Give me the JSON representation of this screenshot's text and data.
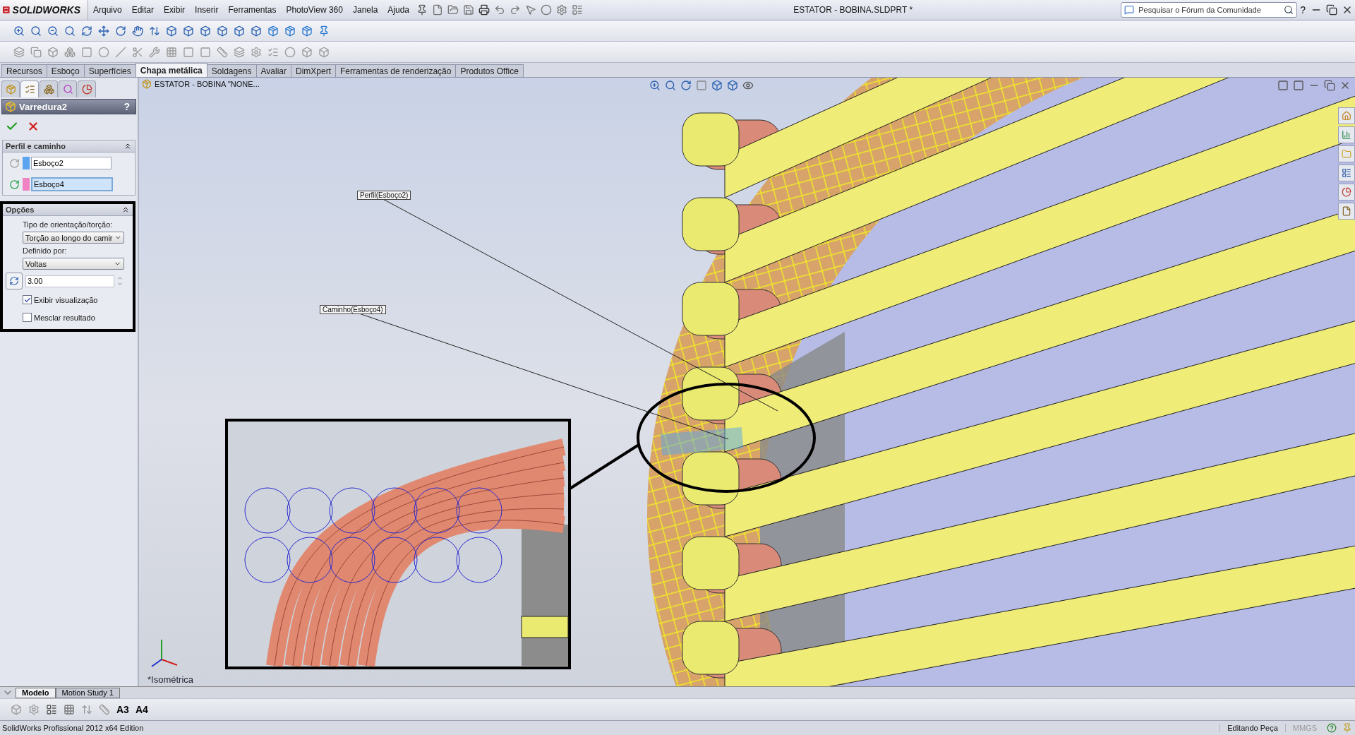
{
  "app": {
    "logo": "SOLIDWORKS"
  },
  "menu": [
    "Arquivo",
    "Editar",
    "Exibir",
    "Inserir",
    "Ferramentas",
    "PhotoView 360",
    "Janela",
    "Ajuda"
  ],
  "window": {
    "title": "ESTATOR - BOBINA.SLDPRT *"
  },
  "search": {
    "placeholder": "Pesquisar o Fórum da Comunidade"
  },
  "help_menu": "?",
  "command_tabs": [
    {
      "label": "Recursos",
      "selected": false
    },
    {
      "label": "Esboço",
      "selected": false
    },
    {
      "label": "Superfícies",
      "selected": false
    },
    {
      "label": "Chapa metálica",
      "selected": true
    },
    {
      "label": "Soldagens",
      "selected": false
    },
    {
      "label": "Avaliar",
      "selected": false
    },
    {
      "label": "DimXpert",
      "selected": false
    },
    {
      "label": "Ferramentas de renderização",
      "selected": false
    },
    {
      "label": "Produtos Office",
      "selected": false
    }
  ],
  "panel_tabs": [
    {
      "selected": false
    },
    {
      "selected": true
    },
    {
      "selected": false
    },
    {
      "selected": false
    },
    {
      "selected": false
    }
  ],
  "property_manager": {
    "title": "Varredura2",
    "help": "?",
    "profile_path": {
      "title": "Perfil e caminho",
      "fields": [
        {
          "value": "Esboço2",
          "color": "#5aa4f0",
          "selected": false
        },
        {
          "value": "Esboço4",
          "color": "#f083c4",
          "selected": true
        }
      ]
    },
    "options": {
      "title": "Opções",
      "orientation_label": "Tipo de orientação/torção:",
      "orientation_value": "Torção ao longo do camir",
      "defined_by_label": "Definido por:",
      "defined_by_value": "Voltas",
      "turns": "3.00",
      "checkboxes": [
        {
          "label": "Exibir visualização",
          "checked": true
        },
        {
          "label": "Mesclar resultado",
          "checked": false
        }
      ]
    }
  },
  "viewport": {
    "tree_root": "ESTATOR - BOBINA \"NONE...",
    "callouts": [
      "Perfil(Esboço2)",
      "Caminho(Esboço4)"
    ],
    "view_name": "*Isométrica"
  },
  "bottom_tabs": [
    {
      "label": "Modelo",
      "selected": true
    },
    {
      "label": "Motion Study 1",
      "selected": false
    }
  ],
  "sheet_buttons": [
    "A3",
    "A4"
  ],
  "status_bar": {
    "product": "SolidWorks Profissional 2012 x64 Edition",
    "mode": "Editando Peça",
    "units": "MMGS"
  }
}
